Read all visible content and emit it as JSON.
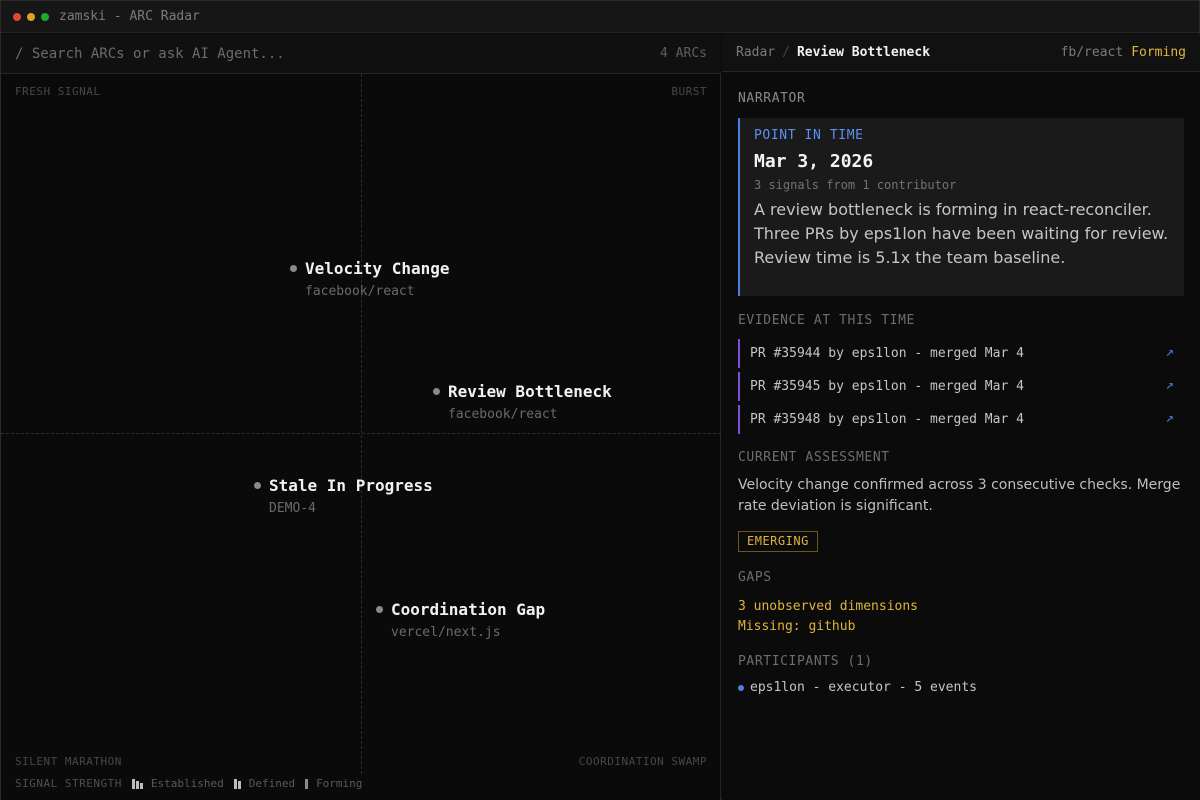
{
  "window": {
    "title": "zamski - ARC Radar",
    "traffic_lights": [
      "#e0443e",
      "#dea123",
      "#1aab29"
    ]
  },
  "search": {
    "placeholder": "/ Search ARCs or ask AI Agent...",
    "count": "4 ARCs"
  },
  "radar": {
    "quadrants": {
      "top_left": "FRESH SIGNAL",
      "top_right": "BURST",
      "bottom_left": "SILENT MARATHON",
      "bottom_right": "COORDINATION SWAMP"
    },
    "arcs": [
      {
        "title": "Velocity Change",
        "repo": "facebook/react"
      },
      {
        "title": "Review Bottleneck",
        "repo": "facebook/react"
      },
      {
        "title": "Stale In Progress",
        "repo": "DEMO-4"
      },
      {
        "title": "Coordination Gap",
        "repo": "vercel/next.js"
      }
    ],
    "legend": {
      "label": "SIGNAL STRENGTH",
      "items": [
        "Established",
        "Defined",
        "Forming"
      ]
    }
  },
  "detail": {
    "breadcrumb": {
      "root": "Radar",
      "separator": "/",
      "current": "Review Bottleneck"
    },
    "repo": "fb/react",
    "status": "Forming",
    "narrator": {
      "heading": "NARRATOR",
      "point_label": "POINT IN TIME",
      "date": "Mar 3, 2026",
      "signals": "3 signals from 1 contributor",
      "text": "A review bottleneck is forming in react-reconciler. Three PRs by eps1lon have been waiting for review. Review time is 5.1x the team baseline."
    },
    "evidence": {
      "heading": "EVIDENCE AT THIS TIME",
      "items": [
        "PR #35944 by eps1lon - merged Mar 4",
        "PR #35945 by eps1lon - merged Mar 4",
        "PR #35948 by eps1lon - merged Mar 4"
      ],
      "link_icon": "↗"
    },
    "assessment": {
      "heading": "CURRENT ASSESSMENT",
      "text": "Velocity change confirmed across 3 consecutive checks. Merge rate deviation is significant.",
      "badge": "EMERGING"
    },
    "gaps": {
      "heading": "GAPS",
      "lines": [
        "3 unobserved dimensions",
        "Missing: github"
      ]
    },
    "participants": {
      "heading": "PARTICIPANTS (1)",
      "items": [
        "eps1lon - executor - 5 events"
      ]
    }
  },
  "colors": {
    "accent_blue": "#4a7fe0",
    "accent_yellow": "#e0b33c",
    "evidence_purple": "#7a52d6"
  }
}
